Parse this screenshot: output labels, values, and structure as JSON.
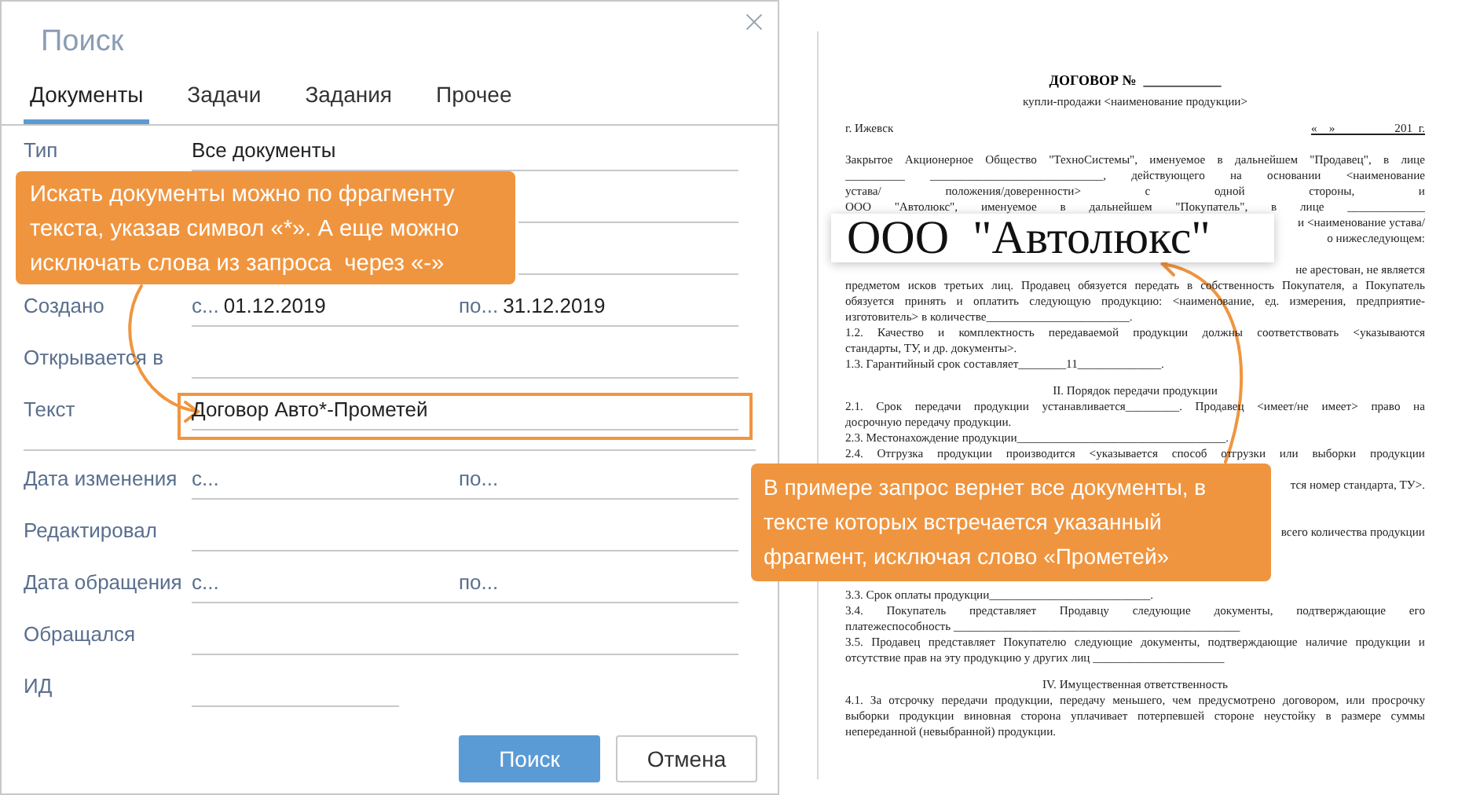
{
  "dialog": {
    "title": "Поиск",
    "tabs": [
      {
        "label": "Документы",
        "selected": true
      },
      {
        "label": "Задачи",
        "selected": false
      },
      {
        "label": "Задания",
        "selected": false
      },
      {
        "label": "Прочее",
        "selected": false
      }
    ],
    "field_groups": [
      [
        {
          "kind": "text",
          "label": "Тип",
          "value": "Все документы",
          "highlighted": false
        },
        {
          "kind": "covered"
        },
        {
          "kind": "covered"
        },
        {
          "kind": "range",
          "label": "Создано",
          "from_prefix": "с...",
          "from_value": "01.12.2019",
          "to_prefix": "по...",
          "to_value": "31.12.2019"
        },
        {
          "kind": "text",
          "label": "Открывается в",
          "highlighted": false
        },
        {
          "kind": "text",
          "label": "Текст",
          "value": "Договор Авто*-Прометей",
          "highlighted": true
        }
      ],
      [
        {
          "kind": "range",
          "label": "Дата изменения",
          "from_prefix": "с...",
          "to_prefix": "по..."
        },
        {
          "kind": "text",
          "label": "Редактировал",
          "highlighted": false
        },
        {
          "kind": "range",
          "label": "Дата обращения",
          "from_prefix": "с...",
          "to_prefix": "по..."
        },
        {
          "kind": "text",
          "label": "Обращался",
          "highlighted": false
        },
        {
          "kind": "short",
          "label": "ИД"
        }
      ]
    ],
    "buttons": [
      {
        "label": "Поиск",
        "primary": true
      },
      {
        "label": "Отмена",
        "primary": false
      }
    ]
  },
  "callouts": [
    {
      "text": "Искать документы можно по фрагменту текста, указав символ «*». А еще можно исключать слова из запроса  через «-»"
    },
    {
      "text": "В примере запрос вернет все документы, в тексте которых встречается указанный фрагмент, исключая слово «Прометей»"
    }
  ],
  "document": {
    "enlarged_text": "ООО  \"Автолюкс\"",
    "lines": [
      {
        "kind": "title",
        "text": "ДОГОВОР №  ___________"
      },
      {
        "kind": "center",
        "text": "купли-продажи <наименование продукции>"
      },
      {
        "kind": "split",
        "left": "г. Ижевск",
        "right": "«    »                    201  г."
      },
      {
        "kind": "blank"
      },
      {
        "kind": "justify",
        "text": "Закрытое Акционерное Общество \"ТехноСистемы\", именуемое в дальнейшем \"Продавец\", в лице"
      },
      {
        "kind": "justify",
        "text": "__________ _____________________________, действующего на основании <наименование"
      },
      {
        "kind": "justify",
        "text": "устава/ положения/доверенности> с одной стороны, и"
      },
      {
        "kind": "justify",
        "text": "ООО \"Автолюкс\", именуемое в дальнейшем \"Покупатель\", в лице _____________"
      },
      {
        "kind": "right",
        "text": "и <наименование устава/"
      },
      {
        "kind": "right",
        "text": "о нижеследующем:"
      },
      {
        "kind": "blank"
      },
      {
        "kind": "right",
        "text": "не арестован, не является"
      },
      {
        "kind": "justify",
        "text": "предметом исков третьих лиц. Продавец обязуется передать в собственность Покупателя, а Покупатель"
      },
      {
        "kind": "justify",
        "text": "обязуется принять и оплатить следующую продукцию: <наименование, ед. измерения, предприятие-"
      },
      {
        "kind": "left",
        "text": "изготовитель> в количестве________________________."
      },
      {
        "kind": "justify",
        "text": "1.2. Качество и комплектность передаваемой продукции должны соответствовать <указываются"
      },
      {
        "kind": "left",
        "text": "стандарты, ТУ, и др. документы>."
      },
      {
        "kind": "left",
        "text": "1.3. Гарантийный срок составляет________11______________."
      },
      {
        "kind": "heading",
        "text": "II. Порядок передачи продукции"
      },
      {
        "kind": "justify",
        "text": "2.1. Срок передачи продукции устанавливается_________. Продавец <имеет/не имеет> право на"
      },
      {
        "kind": "left",
        "text": "досрочную передачу продукции."
      },
      {
        "kind": "left",
        "text": "2.3. Местонахождение продукции___________________________________."
      },
      {
        "kind": "justify",
        "text": "2.4. Отгрузка продукции производится <указывается способ отгрузки или выборки продукции"
      },
      {
        "kind": "blank"
      },
      {
        "kind": "right",
        "text": "тся номер стандарта, ТУ>."
      },
      {
        "kind": "blank"
      },
      {
        "kind": "blank"
      },
      {
        "kind": "right",
        "text": "всего количества продукции"
      },
      {
        "kind": "blank"
      },
      {
        "kind": "blank"
      },
      {
        "kind": "blank"
      },
      {
        "kind": "left",
        "text": "3.3. Срок оплаты продукции___________________________."
      },
      {
        "kind": "justify",
        "text": "3.4. Покупатель представляет Продавцу следующие документы, подтверждающие его"
      },
      {
        "kind": "left",
        "text": "платежеспособность ________________________________________________"
      },
      {
        "kind": "justify",
        "text": "3.5. Продавец представляет Покупателю следующие документы, подтверждающие наличие продукции и"
      },
      {
        "kind": "left",
        "text": "отсутствие прав на эту продукцию у других лиц ______________________"
      },
      {
        "kind": "heading",
        "text": "IV. Имущественная ответственность"
      },
      {
        "kind": "justify",
        "text": "4.1. За отсрочку передачи продукции, передачу меньшего, чем предусмотрено договором, или просрочку"
      },
      {
        "kind": "justify",
        "text": "выборки продукции виновная сторона уплачивает потерпевшей стороне неустойку в размере суммы"
      },
      {
        "kind": "left",
        "text": "непереданной (невыбранной) продукции."
      }
    ]
  }
}
